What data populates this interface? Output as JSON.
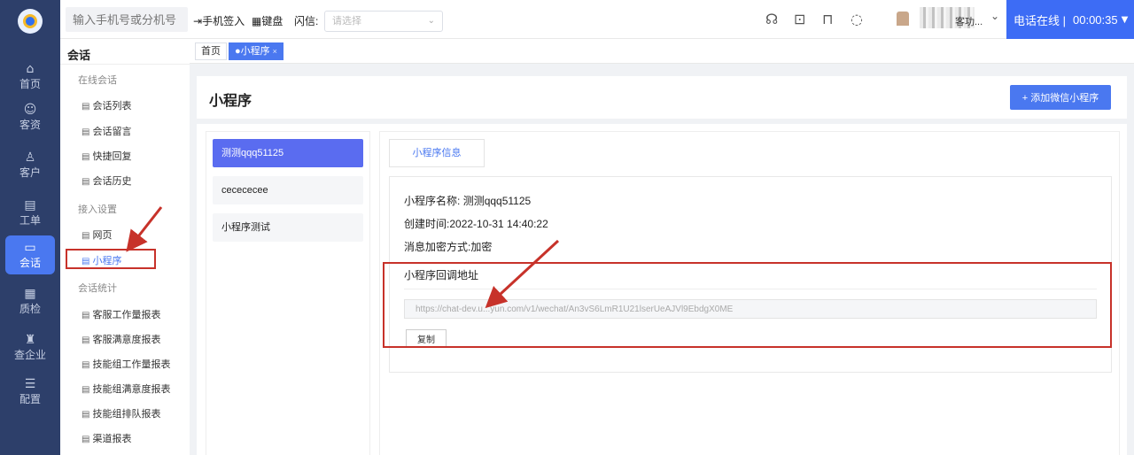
{
  "rail": {
    "items": [
      {
        "label": "首页",
        "icon": "home-icon",
        "glyph": "⌂"
      },
      {
        "label": "客资",
        "icon": "leads-icon",
        "glyph": "☺"
      },
      {
        "label": "客户",
        "icon": "customer-icon",
        "glyph": "♙"
      },
      {
        "label": "工单",
        "icon": "ticket-icon",
        "glyph": "▤"
      },
      {
        "label": "会话",
        "icon": "chat-icon",
        "glyph": "▭"
      },
      {
        "label": "质检",
        "icon": "inspect-icon",
        "glyph": "▦"
      },
      {
        "label": "查企业",
        "icon": "company-icon",
        "glyph": "♜"
      },
      {
        "label": "配置",
        "icon": "config-icon",
        "glyph": "☰"
      }
    ],
    "active_index": 4
  },
  "topbar": {
    "phone_placeholder": "输入手机号或分机号",
    "sign_in": "手机签入",
    "sign_in_glyph": "⇥",
    "keyboard": "键盘",
    "keyboard_glyph": "▦",
    "flash_label": "闪信:",
    "flash_placeholder": "请选择",
    "caret": "⌄",
    "username": "客功...",
    "user_caret": "⌄",
    "phone_status": "电话在线 |",
    "timer": "00:00:35",
    "timer_caret": "▼",
    "icons": {
      "headset": "☊",
      "monitor": "⊡",
      "book": "⊓",
      "message": "◌"
    }
  },
  "subnav": {
    "title": "会话",
    "doc_glyph": "▤",
    "groups": [
      {
        "label": "在线会话",
        "items": [
          "会话列表",
          "会话留言",
          "快捷回复",
          "会话历史"
        ]
      },
      {
        "label": "接入设置",
        "items": [
          "网页",
          "小程序"
        ]
      },
      {
        "label": "会话统计",
        "items": [
          "客服工作量报表",
          "客服满意度报表",
          "技能组工作量报表",
          "技能组满意度报表",
          "技能组排队报表",
          "渠道报表"
        ]
      }
    ],
    "active_item": "小程序"
  },
  "tabs": [
    {
      "label": "首页",
      "active": false
    },
    {
      "label": "●小程序",
      "active": true,
      "close": "×"
    }
  ],
  "page": {
    "title": "小程序",
    "add_button": "+ 添加微信小程序"
  },
  "mini_programs": [
    "测测qqq51125",
    "cecececee",
    "小程序测试"
  ],
  "detail": {
    "tab_label": "小程序信息",
    "name_label": "小程序名称:",
    "name_value": "测测qqq51125",
    "created_label": "创建时间:",
    "created_value": "2022-10-31 14:40:22",
    "encrypt_label": "消息加密方式:",
    "encrypt_value": "加密",
    "callback_title": "小程序回调地址",
    "callback_url": "https://chat-dev.u...yun.com/v1/wechat/An3vS6LmR1U21lserUeAJVl9EbdgX0ME",
    "copy_button": "复制"
  },
  "colors": {
    "accent": "#4a78f0",
    "rail": "#2d3f6a",
    "annotation": "#c7322a",
    "active_item": "#5a6cf0"
  }
}
